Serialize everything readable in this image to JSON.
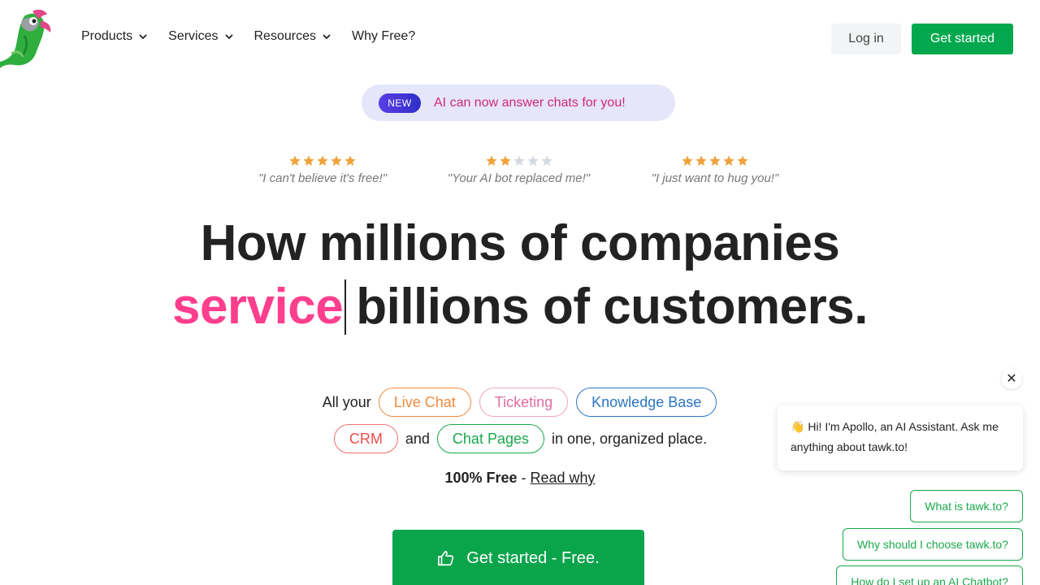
{
  "header": {
    "nav": [
      {
        "label": "Products",
        "has_dropdown": true
      },
      {
        "label": "Services",
        "has_dropdown": true
      },
      {
        "label": "Resources",
        "has_dropdown": true
      },
      {
        "label": "Why Free?",
        "has_dropdown": false
      }
    ],
    "login_label": "Log in",
    "get_started_label": "Get started"
  },
  "announcement": {
    "badge": "NEW",
    "text": "AI can now answer chats for you!"
  },
  "reviews": [
    {
      "rating": 5,
      "quote": "\"I can't believe it's free!\""
    },
    {
      "rating": 2,
      "quote": "\"Your AI bot replaced me!\""
    },
    {
      "rating": 5,
      "quote": "\"I just want to hug you!\""
    }
  ],
  "hero": {
    "line1": "How millions of companies",
    "highlight": "service",
    "line2_rest": "billions of customers."
  },
  "features": {
    "prefix": "All your",
    "tags": [
      "Live Chat",
      "Ticketing",
      "Knowledge Base",
      "CRM",
      "Chat Pages"
    ],
    "and_text": "and",
    "suffix": "in one, organized place."
  },
  "free_line": {
    "bold": "100% Free",
    "separator": " - ",
    "link": "Read why"
  },
  "cta_label": "Get started - Free.",
  "chat_widget": {
    "close_symbol": "✕",
    "message_emoji": "👋",
    "message": "Hi! I'm Apollo, an AI Assistant. Ask me anything about tawk.to!",
    "quick_replies": [
      "What is tawk.to?",
      "Why should I choose tawk.to?",
      "How do I set up an AI Chatbot?"
    ]
  },
  "colors": {
    "brand_green": "#03a84e",
    "highlight_pink": "#ff3e8d",
    "announce_bg": "#e6e6fb",
    "star_gold": "#f0a23a"
  }
}
